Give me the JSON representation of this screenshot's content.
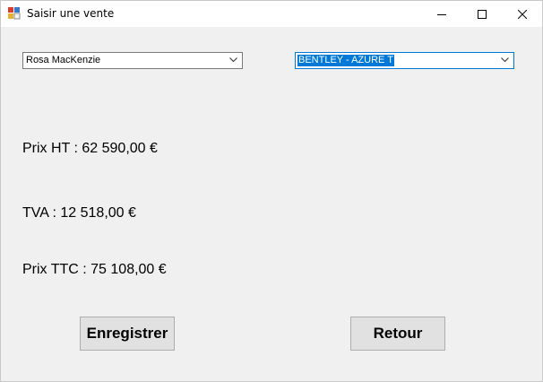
{
  "window": {
    "title": "Saisir une vente",
    "controls": {
      "minimize_icon": "minimize-icon",
      "maximize_icon": "maximize-icon",
      "close_icon": "close-icon"
    }
  },
  "form": {
    "client_select": {
      "value": "Rosa MacKenzie"
    },
    "vehicle_select": {
      "value": "BENTLEY - AZURE T"
    },
    "prix_ht_label": "Prix HT : 62 590,00 €",
    "tva_label": "TVA : 12 518,00 €",
    "prix_ttc_label": "Prix TTC : 75 108,00 €",
    "save_button": "Enregistrer",
    "back_button": "Retour"
  },
  "colors": {
    "accent": "#0078d7",
    "window_bg": "#f0f0f0",
    "button_bg": "#e1e1e1"
  }
}
